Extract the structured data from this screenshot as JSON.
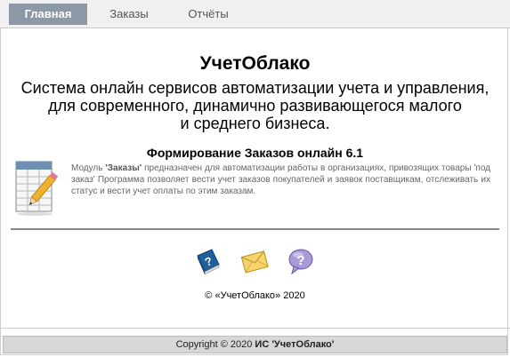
{
  "nav": {
    "tabs": [
      {
        "label": "Главная"
      },
      {
        "label": "Заказы"
      },
      {
        "label": "Отчёты"
      }
    ]
  },
  "hero": {
    "title": "УчетОблако",
    "subtitle_line1": "Система онлайн сервисов автоматизации учета и управления,",
    "subtitle_line2": "для современного, динамично развивающегося малого",
    "subtitle_line3": "и среднего бизнеса."
  },
  "module": {
    "title": "Формирование Заказов онлайн 6.1",
    "desc_prefix": "Модуль ",
    "desc_name": "'Заказы'",
    "desc_rest": " предназначен для автоматизации работы в организациях, привозящих товары 'под заказ' Программа позволяет вести учет заказов покупателей и заявок поставщикам, отслеживать их статус и вести учет оплаты по этим заказам."
  },
  "icons": [
    {
      "name": "help-book-icon"
    },
    {
      "name": "mail-envelope-icon"
    },
    {
      "name": "question-bubble-icon"
    }
  ],
  "copyright_main": "© «УчетОблако» 2020",
  "footer": {
    "prefix": "Copyright © 2020 ",
    "name": "ИС 'УчетОблако'"
  },
  "colors": {
    "active_tab": "#8c98a4",
    "nav_bg": "#f0f0f0",
    "footer_bg": "#d7d7d7"
  }
}
